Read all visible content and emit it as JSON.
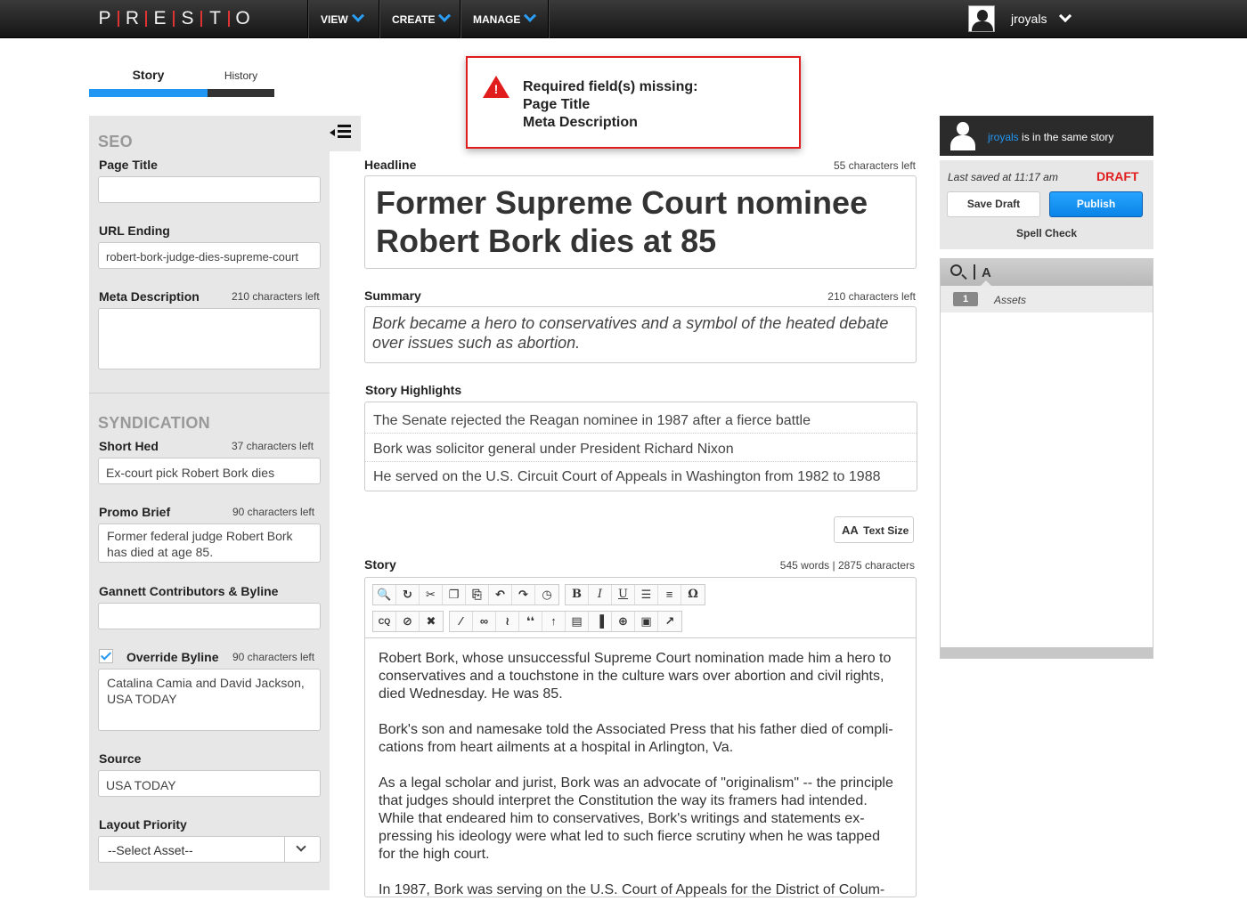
{
  "app": {
    "logo_letters": [
      "P",
      "R",
      "E",
      "S",
      "T",
      "O"
    ]
  },
  "nav": {
    "view": "VIEW",
    "create": "CREATE",
    "manage": "MANAGE",
    "username": "jroyals"
  },
  "tabs": {
    "story": "Story",
    "history": "History"
  },
  "seo": {
    "heading": "SEO",
    "page_title_label": "Page Title",
    "page_title_value": "",
    "url_ending_label": "URL Ending",
    "url_ending_value": "robert-bork-judge-dies-supreme-court",
    "meta_label": "Meta Description",
    "meta_count": "210 characters left",
    "meta_value": ""
  },
  "syndication": {
    "heading": "SYNDICATION",
    "short_hed_label": "Short Hed",
    "short_hed_count": "37 characters left",
    "short_hed_value": "Ex-court pick Robert Bork dies",
    "promo_label": "Promo Brief",
    "promo_count": "90 characters left",
    "promo_value": "Former federal judge Robert Bork has died at age 85.",
    "contributors_label": "Gannett Contributors & Byline",
    "contributors_value": "",
    "override_label": "Override Byline",
    "override_checked": true,
    "override_count": "90 characters left",
    "override_value": "Catalina Camia and David Jackson, USA TODAY",
    "source_label": "Source",
    "source_value": "USA TODAY",
    "layout_label": "Layout Priority",
    "layout_value": "--Select Asset--"
  },
  "main": {
    "headline_label": "Headline",
    "headline_count": "55 characters left",
    "headline_line1": "Former Supreme Court nominee",
    "headline_line2": "Robert Bork dies at 85",
    "summary_label": "Summary",
    "summary_count": "210 characters left",
    "summary_text": "Bork became a hero to conservatives and a symbol of the heated debate over issues such as abortion.",
    "highlights_label": "Story Highlights",
    "highlights": [
      "The Senate rejected the Reagan nominee in 1987 after a fierce battle",
      "Bork was solicitor general under President Richard Nixon",
      "He served on the U.S. Circuit Court of Appeals in Washington from 1982 to 1988"
    ],
    "text_size_aa": "AA",
    "text_size_label": "Text Size",
    "story_label": "Story",
    "story_count": "545 words | 2875 characters",
    "story_paragraphs": [
      "Robert Bork, whose unsuccessful Supreme Court nomination made him a hero to conservatives and a touchstone in the culture wars over abortion and civil rights, died Wednesday. He was 85.",
      "Bork's son and namesake told the Associated Press that his father died of compli-cations from heart ailments at a hospital in Arlington, Va.",
      "As a legal scholar and jurist, Bork was an advocate of \"originalism\" -- the principle that judges should interpret the Constitution the way its framers had intended. While that endeared him to conservatives, Bork's writings and statements ex-pressing his ideology were what led to such fierce scrutiny when he was tapped for the high court.",
      "In 1987, Bork was serving on the U.S. Court of Appeals for the District of Colum-"
    ],
    "toolbar_row1": [
      "binoculars-icon",
      "spellcheck-icon",
      "cut-icon",
      "copy-icon",
      "paste-icon",
      "undo-icon",
      "redo-icon",
      "clock-icon",
      "bold-icon",
      "italic-icon",
      "underline-icon",
      "bulleted-list-icon",
      "numbered-list-icon",
      "omega-icon"
    ],
    "toolbar_row2": [
      "cq-icon",
      "clear-format-icon",
      "unlink-image-icon",
      "wand-icon",
      "link-icon",
      "unlink-icon",
      "quote-icon",
      "insert-icon",
      "source-icon",
      "columns-icon",
      "attach-icon",
      "image-icon",
      "chart-icon"
    ],
    "toolbar_b": "B",
    "toolbar_i": "I",
    "toolbar_u": "U",
    "toolbar_omega": "Ω",
    "toolbar_cq": "CQ",
    "toolbar_quote": "❛❛"
  },
  "alert": {
    "line1": "Required field(s) missing:",
    "line2": "Page Title",
    "line3": "Meta Description",
    "icon_glyph": "!",
    "color": "#e11c1c"
  },
  "right": {
    "presence_user": "jroyals",
    "presence_text": " is in the same story",
    "last_saved": "Last saved at 11:17 am",
    "status": "DRAFT",
    "save_draft": "Save Draft",
    "publish": "Publish",
    "spell_check": "Spell Check",
    "assets_letter": "A",
    "assets_count": "1",
    "assets_label": "Assets",
    "accent_color": "#2196f3"
  }
}
